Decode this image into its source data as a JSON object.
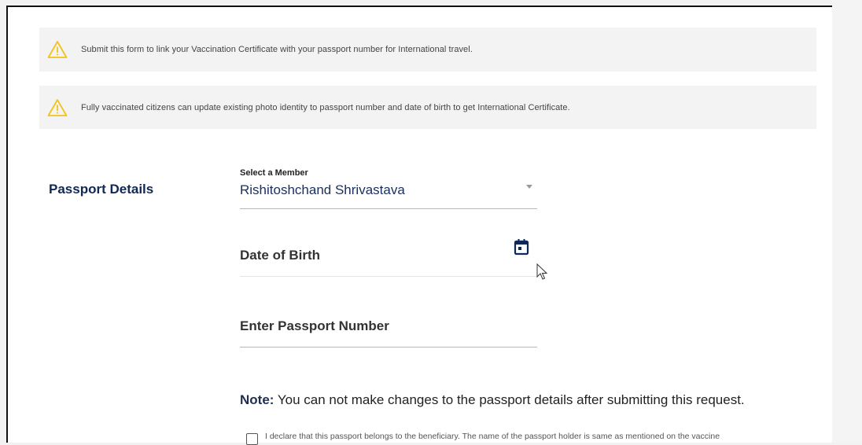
{
  "alerts": [
    {
      "icon": "warning-icon",
      "text": "Submit this form to link your Vaccination Certificate with your passport number for International travel."
    },
    {
      "icon": "warning-icon",
      "text": "Fully vaccinated citizens can update existing photo identity to passport number and date of birth to get International Certificate."
    }
  ],
  "section": {
    "title": "Passport Details"
  },
  "member_select": {
    "caption": "Select a Member",
    "value": "Rishitoshchand Shrivastava"
  },
  "dob_field": {
    "placeholder": "Date of Birth",
    "icon": "calendar-icon"
  },
  "passport_field": {
    "placeholder": "Enter Passport Number"
  },
  "note": {
    "label": "Note:",
    "text": " You can not make changes to the passport details after submitting this request."
  },
  "declaration": {
    "checked": false,
    "text": "I declare that this passport belongs to the beneficiary. The name of the passport holder is same as mentioned on the vaccine"
  },
  "colors": {
    "accent_navy": "#0f2855",
    "warning_yellow": "#f5c518",
    "alert_bg": "#f3f3f3"
  }
}
